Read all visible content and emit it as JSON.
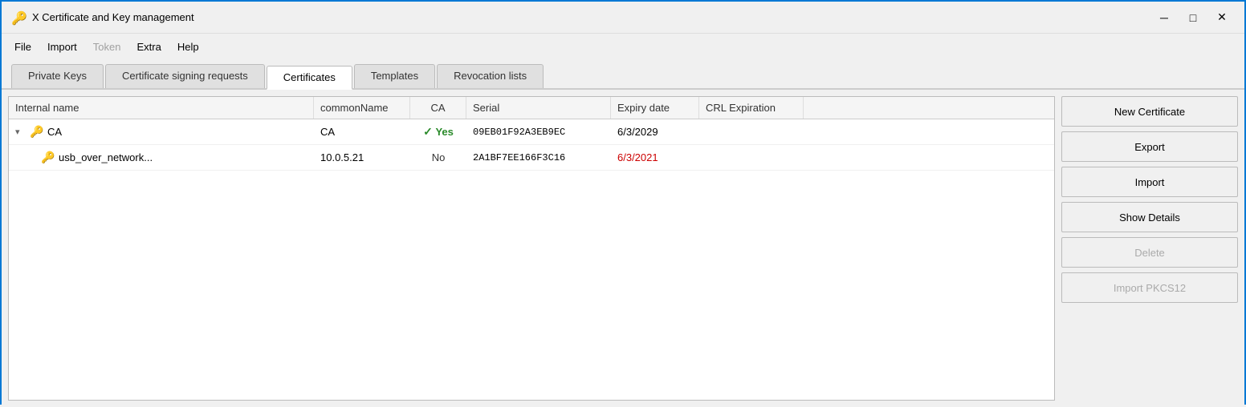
{
  "window": {
    "title": "X Certificate and Key management",
    "icon": "🔑"
  },
  "titlebar": {
    "minimize_label": "─",
    "maximize_label": "□",
    "close_label": "✕"
  },
  "menu": {
    "items": [
      {
        "label": "File",
        "disabled": false
      },
      {
        "label": "Import",
        "disabled": false
      },
      {
        "label": "Token",
        "disabled": true
      },
      {
        "label": "Extra",
        "disabled": false
      },
      {
        "label": "Help",
        "disabled": false
      }
    ]
  },
  "tabs": [
    {
      "label": "Private Keys",
      "active": false
    },
    {
      "label": "Certificate signing requests",
      "active": false
    },
    {
      "label": "Certificates",
      "active": true
    },
    {
      "label": "Templates",
      "active": false
    },
    {
      "label": "Revocation lists",
      "active": false
    }
  ],
  "table": {
    "columns": [
      {
        "label": "Internal name",
        "key": "internal_name"
      },
      {
        "label": "commonName",
        "key": "common_name"
      },
      {
        "label": "CA",
        "key": "ca"
      },
      {
        "label": "Serial",
        "key": "serial"
      },
      {
        "label": "Expiry date",
        "key": "expiry"
      },
      {
        "label": "CRL Expiration",
        "key": "crl"
      }
    ],
    "rows": [
      {
        "id": "root",
        "internal_name": "CA",
        "common_name": "CA",
        "ca": "Yes",
        "ca_check": true,
        "serial": "09EB01F92A3EB9EC",
        "expiry": "6/3/2029",
        "expiry_expired": false,
        "crl": "",
        "expanded": true,
        "indent": 0
      },
      {
        "id": "child1",
        "internal_name": "usb_over_network...",
        "common_name": "10.0.5.21",
        "ca": "No",
        "ca_check": false,
        "serial": "2A1BF7EE166F3C16",
        "expiry": "6/3/2021",
        "expiry_expired": true,
        "crl": "",
        "expanded": false,
        "indent": 1
      }
    ]
  },
  "sidebar": {
    "buttons": [
      {
        "label": "New Certificate",
        "disabled": false,
        "key": "new_cert"
      },
      {
        "label": "Export",
        "disabled": false,
        "key": "export"
      },
      {
        "label": "Import",
        "disabled": false,
        "key": "import"
      },
      {
        "label": "Show Details",
        "disabled": false,
        "key": "show_details"
      },
      {
        "label": "Delete",
        "disabled": true,
        "key": "delete"
      },
      {
        "label": "Import PKCS12",
        "disabled": true,
        "key": "import_pkcs12"
      }
    ]
  }
}
